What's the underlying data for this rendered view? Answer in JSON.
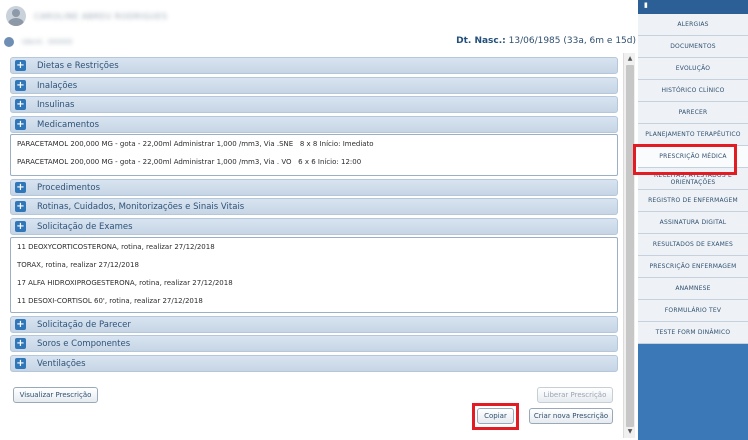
{
  "patient": {
    "name_blurred": "CAROLINE ABREU RODRIGUES",
    "info_blurred": "Ident. 00000",
    "dob_label": "Dt. Nasc.:",
    "dob_value": " 13/06/1985 (33a, 6m e 15d)"
  },
  "sections": [
    {
      "title": "Dietas e Restrições",
      "expanded": false
    },
    {
      "title": "Inalações",
      "expanded": false
    },
    {
      "title": "Insulinas",
      "expanded": false
    },
    {
      "title": "Medicamentos",
      "expanded": true,
      "lines": [
        "PARACETAMOL 200,000 MG - gota - 22,00ml Administrar 1,000 /mm3, Via .SNE   8 x 8 Início: Imediato",
        "PARACETAMOL 200,000 MG - gota - 22,00ml Administrar 1,000 /mm3, Via . VO   6 x 6 Início: 12:00"
      ]
    },
    {
      "title": "Procedimentos",
      "expanded": false
    },
    {
      "title": "Rotinas, Cuidados, Monitorizações e Sinais Vitais",
      "expanded": false
    },
    {
      "title": "Solicitação de Exames",
      "expanded": true,
      "lines": [
        "11 DEOXYCORTICOSTERONA, rotina, realizar 27/12/2018",
        "TORAX, rotina, realizar 27/12/2018",
        "17 ALFA HIDROXIPROGESTERONA, rotina, realizar 27/12/2018",
        "11 DESOXI-CORTISOL 60', rotina, realizar 27/12/2018"
      ]
    },
    {
      "title": "Solicitação de Parecer",
      "expanded": false
    },
    {
      "title": "Soros e Componentes",
      "expanded": false
    },
    {
      "title": "Ventilações",
      "expanded": false
    }
  ],
  "buttons": {
    "visualizar": "Visualizar Prescrição",
    "liberar": "Liberar Prescrição",
    "copiar": "Copiar",
    "criar": "Criar nova Prescrição"
  },
  "sidebar": {
    "items": [
      {
        "label": "ALERGIAS"
      },
      {
        "label": "DOCUMENTOS"
      },
      {
        "label": "EVOLUÇÃO"
      },
      {
        "label": "HISTÓRICO CLÍNICO"
      },
      {
        "label": "PARECER"
      },
      {
        "label": "PLANEJAMENTO TERAPÊUTICO"
      },
      {
        "label": "PRESCRIÇÃO MÉDICA",
        "active": true
      },
      {
        "label": "RECEITAS, ATESTADOS E ORIENTAÇÕES"
      },
      {
        "label": "REGISTRO DE ENFERMAGEM"
      },
      {
        "label": "ASSINATURA DIGITAL"
      },
      {
        "label": "RESULTADOS DE EXAMES"
      },
      {
        "label": "PRESCRIÇÃO ENFERMAGEM"
      },
      {
        "label": "ANAMNESE"
      },
      {
        "label": "FORMULÁRIO TEV"
      },
      {
        "label": "TESTE FORM DINÂMICO"
      }
    ]
  },
  "colors": {
    "highlight": "#e31b23",
    "sidebar_bg": "#3b78b7",
    "accordion_header": "#c6d5e5"
  },
  "icons": {
    "expand": "plus-icon",
    "sidebar_top": "bell-icon",
    "patient": "user-avatar-icon"
  }
}
